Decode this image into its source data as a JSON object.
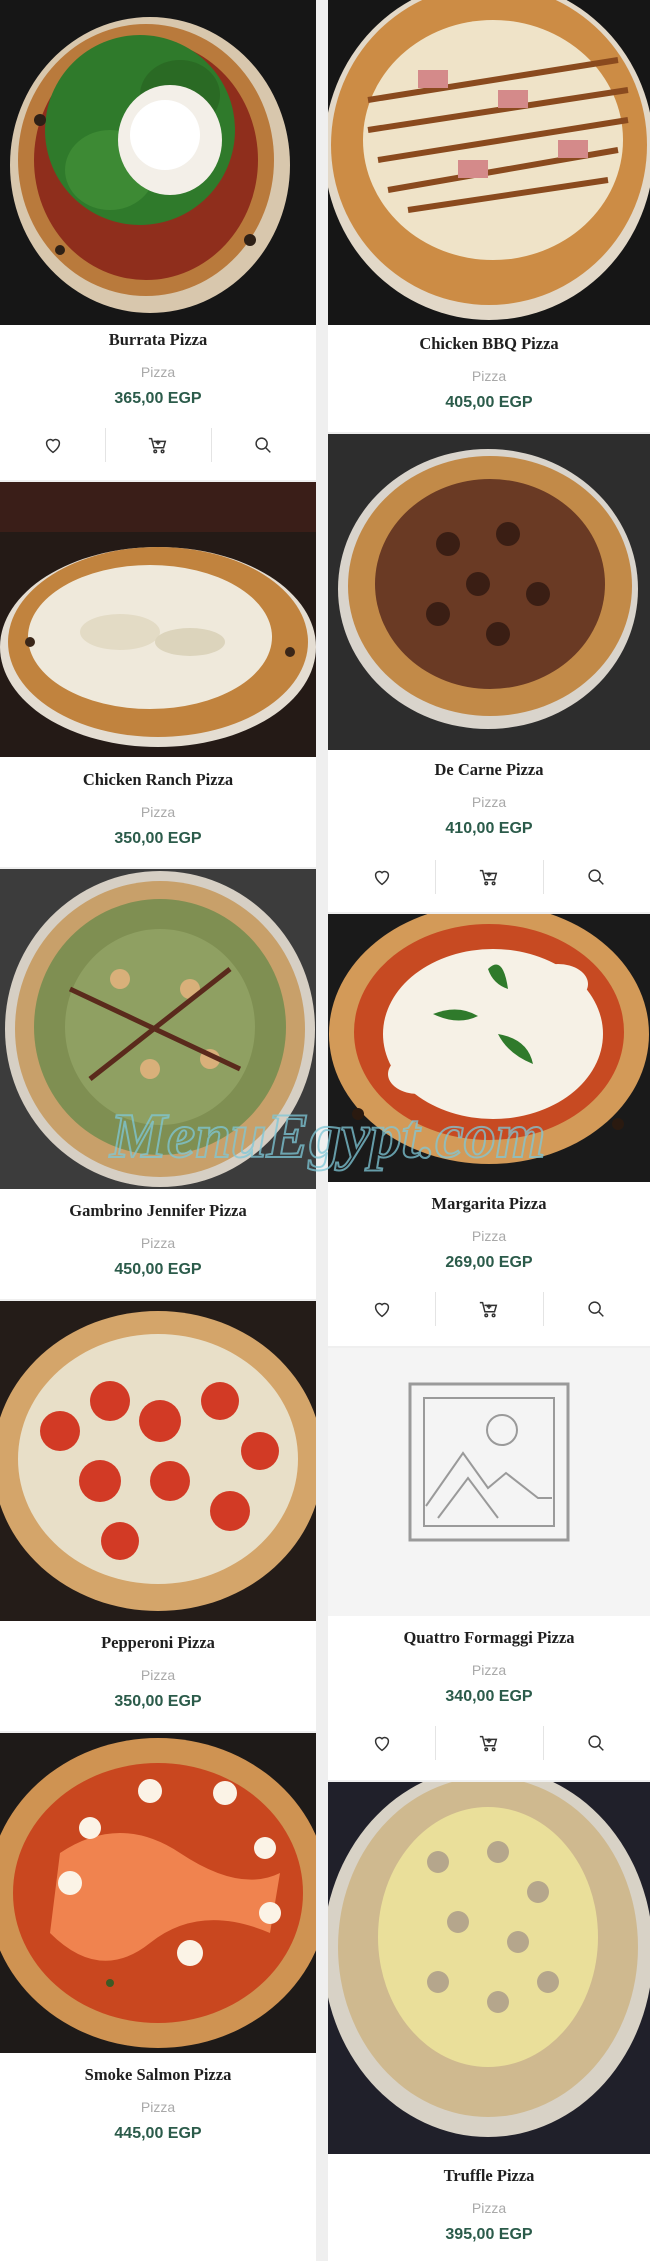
{
  "products": [
    {
      "name": "Burrata Pizza",
      "category": "Pizza",
      "price": "365,00 EGP"
    },
    {
      "name": "Chicken BBQ Pizza",
      "category": "Pizza",
      "price": "405,00 EGP"
    },
    {
      "name": "Chicken Ranch Pizza",
      "category": "Pizza",
      "price": "350,00 EGP"
    },
    {
      "name": "De Carne Pizza",
      "category": "Pizza",
      "price": "410,00 EGP"
    },
    {
      "name": "Gambrino Jennifer Pizza",
      "category": "Pizza",
      "price": "450,00 EGP"
    },
    {
      "name": "Margarita Pizza",
      "category": "Pizza",
      "price": "269,00 EGP"
    },
    {
      "name": "Pepperoni Pizza",
      "category": "Pizza",
      "price": "350,00 EGP"
    },
    {
      "name": "Quattro Formaggi Pizza",
      "category": "Pizza",
      "price": "340,00 EGP"
    },
    {
      "name": "Smoke Salmon Pizza",
      "category": "Pizza",
      "price": "445,00 EGP"
    },
    {
      "name": "Truffle Pizza",
      "category": "Pizza",
      "price": "395,00 EGP"
    }
  ],
  "icons": {
    "wishlist": "heart-icon",
    "cart": "cart-icon",
    "quick_view": "search-icon",
    "placeholder": "image-placeholder-icon"
  },
  "watermark": {
    "text": "MenuEgypt.com"
  },
  "colors": {
    "price": "#2b5b4a",
    "category": "#a9a9a9",
    "name": "#1f1f1f"
  }
}
